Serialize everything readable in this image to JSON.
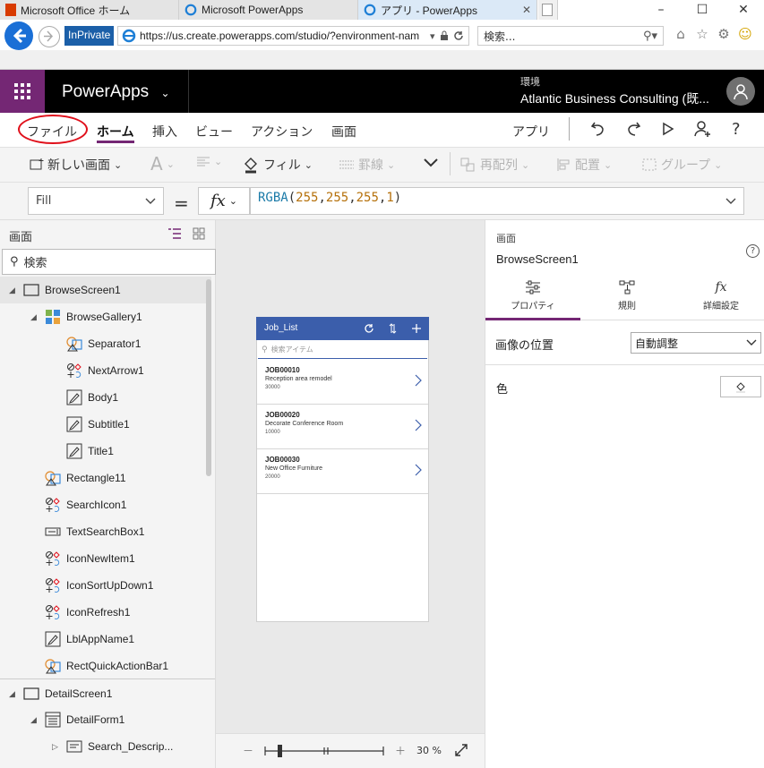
{
  "browser": {
    "inprivate_label": "InPrivate",
    "url": "https://us.create.powerapps.com/studio/?environment-nam",
    "search_placeholder": "検索...",
    "tabs": [
      {
        "label": "Microsoft Office ホーム",
        "icon": "office-icon"
      },
      {
        "label": "Microsoft PowerApps",
        "icon": "ie-icon"
      },
      {
        "label": "アプリ - PowerApps",
        "icon": "ie-icon",
        "active": true
      }
    ]
  },
  "header": {
    "app_name": "PowerApps",
    "env_label": "環境",
    "env_name": "Atlantic Business Consulting (既..."
  },
  "menu": {
    "items": [
      "ファイル",
      "ホーム",
      "挿入",
      "ビュー",
      "アクション",
      "画面"
    ],
    "active_index": 1,
    "app_label": "アプリ"
  },
  "toolbar": {
    "new_screen": "新しい画面",
    "font_glyph": "A",
    "fill": "フィル",
    "border": "罫線",
    "reorder": "再配列",
    "align": "配置",
    "group": "グループ"
  },
  "formula": {
    "property": "Fill",
    "eq": "=",
    "fx": "fx",
    "fn": "RGBA",
    "open": "(",
    "r": "255",
    "g": "255",
    "b": "255",
    "a": "1",
    "comma": ",",
    "close": ")"
  },
  "tree": {
    "title": "画面",
    "search": "検索",
    "items": [
      {
        "label": "BrowseScreen1",
        "level": 0,
        "icon": "screen-icon",
        "expanded": true,
        "selected": true
      },
      {
        "label": "BrowseGallery1",
        "level": 1,
        "icon": "gallery-icon",
        "expanded": true
      },
      {
        "label": "Separator1",
        "level": 2,
        "icon": "shape-icon"
      },
      {
        "label": "NextArrow1",
        "level": 2,
        "icon": "icons-control-icon"
      },
      {
        "label": "Body1",
        "level": 2,
        "icon": "label-icon"
      },
      {
        "label": "Subtitle1",
        "level": 2,
        "icon": "label-icon"
      },
      {
        "label": "Title1",
        "level": 2,
        "icon": "label-icon"
      },
      {
        "label": "Rectangle11",
        "level": 1,
        "icon": "shape-icon"
      },
      {
        "label": "SearchIcon1",
        "level": 1,
        "icon": "icons-control-icon"
      },
      {
        "label": "TextSearchBox1",
        "level": 1,
        "icon": "textinput-icon"
      },
      {
        "label": "IconNewItem1",
        "level": 1,
        "icon": "icons-control-icon"
      },
      {
        "label": "IconSortUpDown1",
        "level": 1,
        "icon": "icons-control-icon"
      },
      {
        "label": "IconRefresh1",
        "level": 1,
        "icon": "icons-control-icon"
      },
      {
        "label": "LblAppName1",
        "level": 1,
        "icon": "label-icon"
      },
      {
        "label": "RectQuickActionBar1",
        "level": 1,
        "icon": "shape-icon"
      },
      {
        "label": "DetailScreen1",
        "level": 0,
        "icon": "screen-icon",
        "expanded": true
      },
      {
        "label": "DetailForm1",
        "level": 1,
        "icon": "form-icon",
        "expanded": true
      },
      {
        "label": "Search_Descrip...",
        "level": 2,
        "icon": "card-icon",
        "collapsed": true
      }
    ]
  },
  "canvas": {
    "title": "Job_List",
    "search_placeholder": "検索アイテム",
    "rows": [
      {
        "title": "JOB00010",
        "subtitle": "Reception area remodel",
        "body": "30000"
      },
      {
        "title": "JOB00020",
        "subtitle": "Decorate Conference Room",
        "body": "10000"
      },
      {
        "title": "JOB00030",
        "subtitle": "New Office Furniture",
        "body": "20000"
      }
    ],
    "zoom_minus": "－",
    "zoom_plus": "＋",
    "zoom": "30 %"
  },
  "props": {
    "kind": "画面",
    "name": "BrowseScreen1",
    "tabs": [
      "プロパティ",
      "規則",
      "詳細設定"
    ],
    "image_position_label": "画像の位置",
    "image_position_value": "自動調整",
    "color_label": "色"
  },
  "colors": {
    "accent": "#742774",
    "header_bg": "#000000",
    "gallery_header": "#3b5eab",
    "highlight_ring": "#e0101b"
  }
}
